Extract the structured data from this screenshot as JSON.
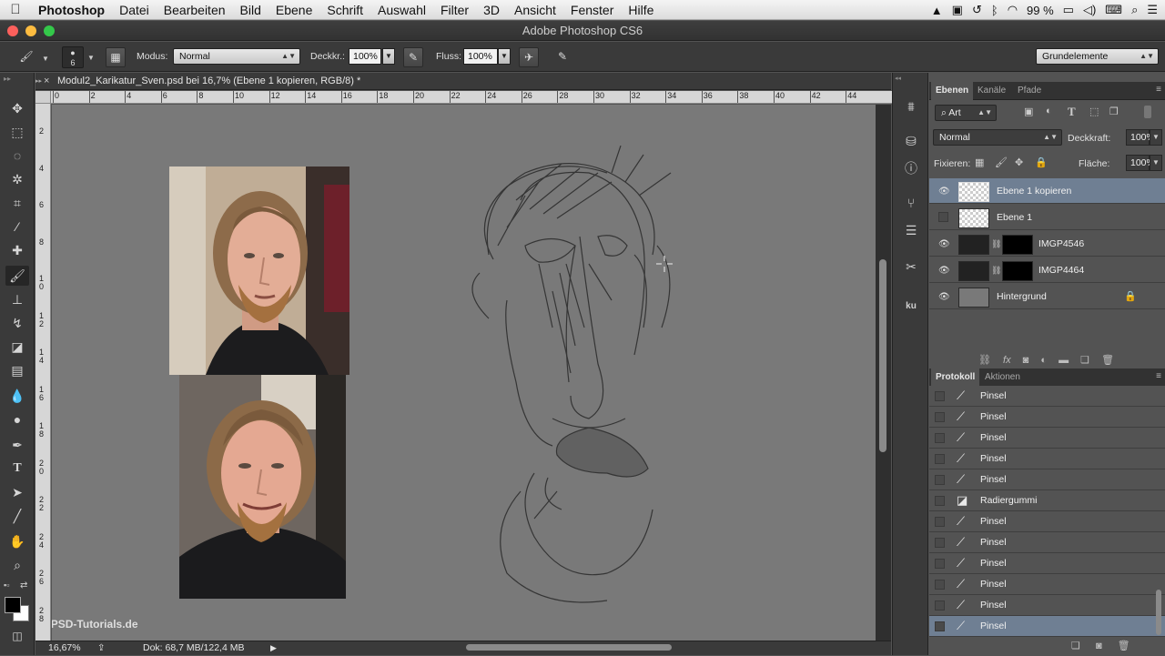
{
  "menubar": {
    "app": "Photoshop",
    "items": [
      "Datei",
      "Bearbeiten",
      "Bild",
      "Ebene",
      "Schrift",
      "Auswahl",
      "Filter",
      "3D",
      "Ansicht",
      "Fenster",
      "Hilfe"
    ],
    "battery": "99 %"
  },
  "window": {
    "title": "Adobe Photoshop CS6"
  },
  "options": {
    "brush_size": "6",
    "modus_label": "Modus:",
    "modus_value": "Normal",
    "deckkr_label": "Deckkr.:",
    "deckkr_value": "100%",
    "fluss_label": "Fluss:",
    "fluss_value": "100%",
    "workspace": "Grundelemente"
  },
  "document": {
    "tab_title": "Modul2_Karikatur_Sven.psd bei 16,7% (Ebene 1 kopieren, RGB/8) *",
    "ruler_top": [
      "0",
      "2",
      "4",
      "6",
      "8",
      "10",
      "12",
      "14",
      "16",
      "18",
      "20",
      "22",
      "24",
      "26",
      "28",
      "30",
      "32",
      "34",
      "36",
      "38",
      "40",
      "42",
      "44"
    ],
    "ruler_left": [
      "2",
      "4",
      "6",
      "8",
      "10",
      "12",
      "14",
      "16",
      "18",
      "20",
      "22",
      "24",
      "26",
      "28"
    ],
    "zoom": "16,67%",
    "doc_info": "Dok: 68,7 MB/122,4 MB",
    "watermark": "PSD-Tutorials.de"
  },
  "layers_panel": {
    "tabs": [
      "Ebenen",
      "Kanäle",
      "Pfade"
    ],
    "filter": "Art",
    "blend_mode": "Normal",
    "opacity_label": "Deckkraft:",
    "opacity": "100%",
    "lock_label": "Fixieren:",
    "fill_label": "Fläche:",
    "fill": "100%",
    "layers": [
      {
        "name": "Ebene 1 kopieren",
        "visible": true,
        "selected": true
      },
      {
        "name": "Ebene 1",
        "visible": false,
        "selected": false
      },
      {
        "name": "IMGP4546",
        "visible": true,
        "selected": false
      },
      {
        "name": "IMGP4464",
        "visible": true,
        "selected": false
      },
      {
        "name": "Hintergrund",
        "visible": true,
        "selected": false,
        "locked": true
      }
    ]
  },
  "history_panel": {
    "tabs": [
      "Protokoll",
      "Aktionen"
    ],
    "items": [
      {
        "name": "Pinsel",
        "icon": "brush-icon"
      },
      {
        "name": "Pinsel",
        "icon": "brush-icon"
      },
      {
        "name": "Pinsel",
        "icon": "brush-icon"
      },
      {
        "name": "Pinsel",
        "icon": "brush-icon"
      },
      {
        "name": "Pinsel",
        "icon": "brush-icon"
      },
      {
        "name": "Radiergummi",
        "icon": "eraser-icon"
      },
      {
        "name": "Pinsel",
        "icon": "brush-icon"
      },
      {
        "name": "Pinsel",
        "icon": "brush-icon"
      },
      {
        "name": "Pinsel",
        "icon": "brush-icon"
      },
      {
        "name": "Pinsel",
        "icon": "brush-icon"
      },
      {
        "name": "Pinsel",
        "icon": "brush-icon"
      },
      {
        "name": "Pinsel",
        "icon": "brush-icon",
        "selected": true
      }
    ]
  }
}
